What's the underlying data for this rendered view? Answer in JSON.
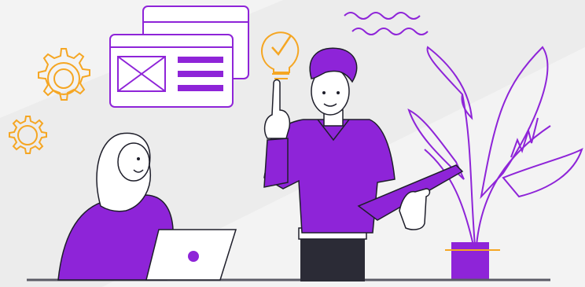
{
  "colors": {
    "background": "#f3f3f3",
    "background_diagonal": "#ececec",
    "accent_purple": "#8e24d8",
    "accent_orange": "#f5a623",
    "outline": "#1e1e2a",
    "skin": "#ffffff",
    "pants": "#2b2b36",
    "floor_line": "#5b5b66"
  },
  "icons": {
    "gears": "gear-icon",
    "wireframe": "wireframe-window-icon",
    "lightbulb": "lightbulb-check-icon",
    "waves": "wavy-lines-decoration",
    "plant": "banana-plant-illustration"
  }
}
